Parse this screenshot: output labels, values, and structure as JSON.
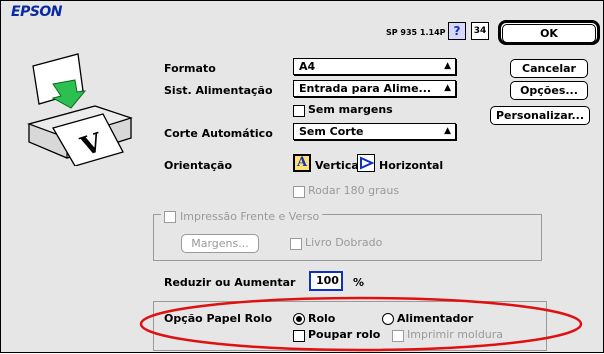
{
  "header": {
    "brand": "EPSON",
    "version": "SP 935 1.14P",
    "help_label": "?",
    "info_label": "34"
  },
  "buttons": {
    "ok": "OK",
    "cancel": "Cancelar",
    "options": "Opções...",
    "customize": "Personalizar..."
  },
  "form": {
    "format_label": "Formato",
    "format_value": "A4",
    "feed_label": "Sist. Alimentação",
    "feed_value": "Entrada para Alime...",
    "no_margins_label": "Sem margens",
    "auto_cut_label": "Corte Automático",
    "auto_cut_value": "Sem Corte",
    "orientation_label": "Orientação",
    "orientation_options": [
      "Vertical",
      "Horizontal"
    ],
    "rotate_label": "Rodar 180 graus",
    "duplex_label": "Impressão Frente e Verso",
    "margins_button": "Margens...",
    "folded_booklet_label": "Livro Dobrado",
    "reduce_label": "Reduzir ou Aumentar",
    "reduce_value": "100",
    "percent_symbol": "%",
    "roll_option_label": "Opção Papel Rolo",
    "roll_radio": "Rolo",
    "feeder_radio": "Alimentador",
    "save_roll_label": "Poupar rolo",
    "print_frame_label": "Imprimir moldura"
  },
  "colors": {
    "brand": "#0a2aa0",
    "highlight": "#e01010",
    "dialog_bg": "#e6e6e6"
  }
}
